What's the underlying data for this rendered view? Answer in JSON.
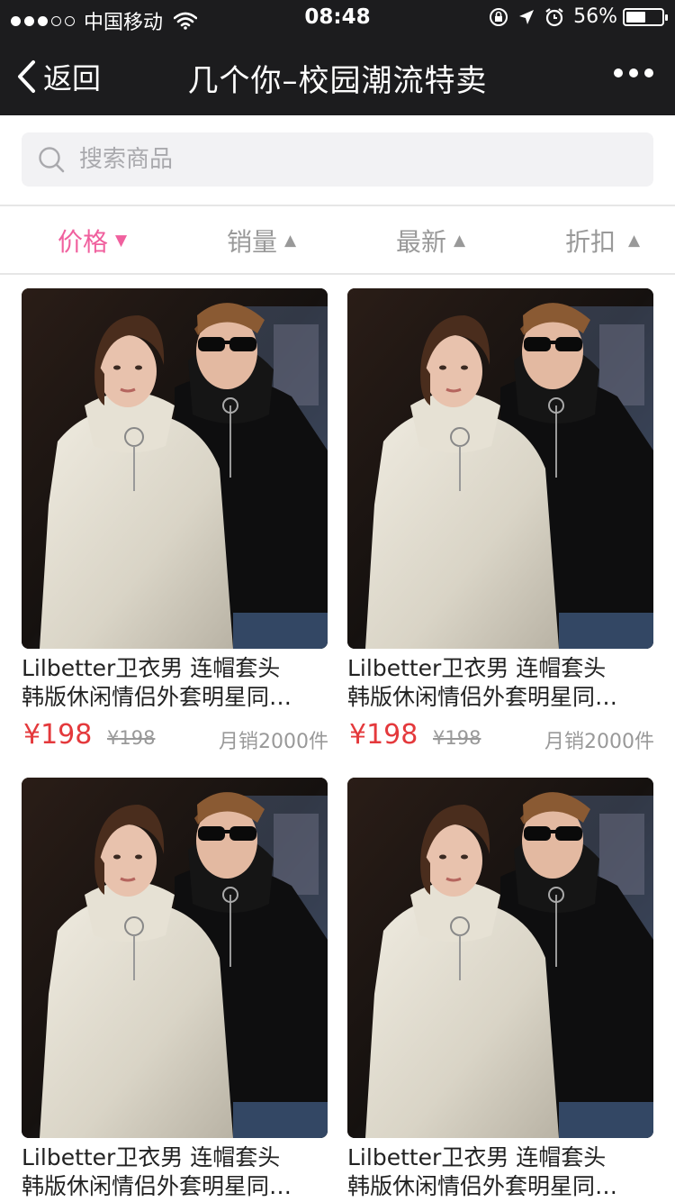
{
  "status_bar": {
    "carrier": "中国移动",
    "time": "08:48",
    "battery_percent": "56%",
    "battery_level": 0.56,
    "signal_bars_filled": 3,
    "signal_bars_total": 5,
    "icons": [
      "signal-dots-icon",
      "wifi-icon",
      "rotation-lock-icon",
      "location-arrow-icon",
      "alarm-icon",
      "battery-icon"
    ]
  },
  "nav": {
    "back_label": "返回",
    "title": "几个你–校园潮流特卖",
    "more_icon": "more-dots-icon"
  },
  "search": {
    "placeholder": "搜索商品",
    "value": "",
    "icon": "search-icon"
  },
  "sort_tabs": [
    {
      "label": "价格",
      "arrow": "▼",
      "active": true
    },
    {
      "label": "销量",
      "arrow": "▲",
      "active": false
    },
    {
      "label": "最新",
      "arrow": "▲",
      "active": false
    },
    {
      "label": "折扣",
      "arrow": "▲",
      "active": false
    }
  ],
  "colors": {
    "top_bar": "#1c1c1e",
    "active_tab": "#f0609e",
    "price": "#e4393c",
    "muted": "#999999",
    "search_bg": "#f2f2f4"
  },
  "products": [
    {
      "title_line1": "Lilbetter卫衣男 连帽套头",
      "title_line2": "韩版休闲情侣外套明星同…",
      "price": "¥198",
      "original_price": "¥198",
      "sales": "月销2000件"
    },
    {
      "title_line1": "Lilbetter卫衣男 连帽套头",
      "title_line2": "韩版休闲情侣外套明星同…",
      "price": "¥198",
      "original_price": "¥198",
      "sales": "月销2000件"
    },
    {
      "title_line1": "Lilbetter卫衣男 连帽套头",
      "title_line2": "韩版休闲情侣外套明星同…",
      "price": "",
      "original_price": "",
      "sales": ""
    },
    {
      "title_line1": "Lilbetter卫衣男 连帽套头",
      "title_line2": "韩版休闲情侣外套明星同…",
      "price": "",
      "original_price": "",
      "sales": ""
    }
  ]
}
